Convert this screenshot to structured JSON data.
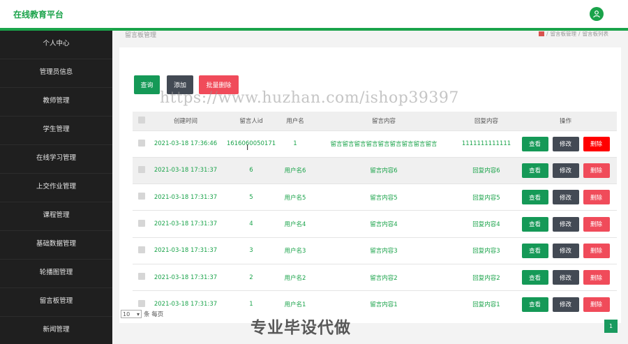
{
  "header": {
    "title": "在线教育平台"
  },
  "sidebar": {
    "items": [
      "个人中心",
      "管理员信息",
      "教师管理",
      "学生管理",
      "在线学习管理",
      "上交作业管理",
      "课程管理",
      "基础数据管理",
      "轮播图管理",
      "留言板管理",
      "新闻管理"
    ]
  },
  "breadcrumb": {
    "page_title": "留言板管理",
    "path_1": "留言板管理",
    "sep": "/",
    "path_2": "留言板列表"
  },
  "toolbar": {
    "query": "查询",
    "add": "添加",
    "batch_delete": "批量删除"
  },
  "watermark": "https://www.huzhan.com/ishop39397",
  "table": {
    "headers": [
      "创建时间",
      "留言人id",
      "用户名",
      "留言内容",
      "回复内容",
      "操作"
    ],
    "rows": [
      {
        "time": "2021-03-18 17:36:46",
        "uid": "1616060050171",
        "user": "1",
        "msg": "留言留言留言留言留言留言留言留言留言",
        "reply": "1111111111111"
      },
      {
        "time": "2021-03-18 17:31:37",
        "uid": "6",
        "user": "用户名6",
        "msg": "留言内容6",
        "reply": "回复内容6"
      },
      {
        "time": "2021-03-18 17:31:37",
        "uid": "5",
        "user": "用户名5",
        "msg": "留言内容5",
        "reply": "回复内容5"
      },
      {
        "time": "2021-03-18 17:31:37",
        "uid": "4",
        "user": "用户名4",
        "msg": "留言内容4",
        "reply": "回复内容4"
      },
      {
        "time": "2021-03-18 17:31:37",
        "uid": "3",
        "user": "用户名3",
        "msg": "留言内容3",
        "reply": "回复内容3"
      },
      {
        "time": "2021-03-18 17:31:37",
        "uid": "2",
        "user": "用户名2",
        "msg": "留言内容2",
        "reply": "回复内容2"
      },
      {
        "time": "2021-03-18 17:31:37",
        "uid": "1",
        "user": "用户名1",
        "msg": "留言内容1",
        "reply": "回复内容1"
      }
    ],
    "actions": {
      "view": "查看",
      "edit": "修改",
      "delete": "删除"
    }
  },
  "pagination": {
    "page_size": "10",
    "per_page_label": "条 每页",
    "current_page": "1"
  },
  "promo_text": "专业毕设代做",
  "colors": {
    "accent": "#1aa34a",
    "sidebar": "#1f1f1f",
    "danger": "#f04b5a",
    "dark": "#434a54"
  }
}
